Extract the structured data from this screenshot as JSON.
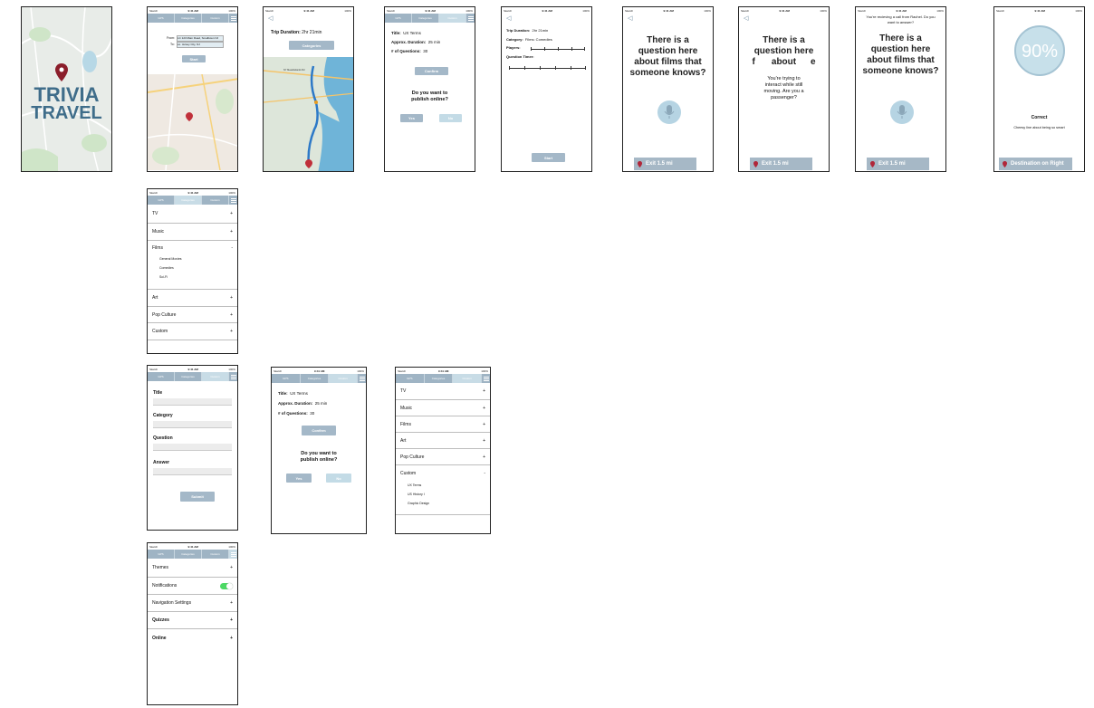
{
  "status": {
    "carrier": "Sketch",
    "time": "9:41 AM",
    "battery": "100%"
  },
  "tabs": [
    "GPS",
    "Categories",
    "Custom"
  ],
  "splash": {
    "title_line1": "TRIVIA",
    "title_line2": "TRAVEL"
  },
  "gps": {
    "from_label": "From:",
    "from_value": "LC 123 Main Road, Smalltown NJ",
    "to_label": "To:",
    "to_value": "ex. Jersey City, NJ",
    "start": "Start"
  },
  "route": {
    "trip_label": "Trip Duration:",
    "trip_value": "2hr 21min",
    "categories_btn": "Categories",
    "map_label1": "NY Meadowlands Rd"
  },
  "confirm": {
    "title_label": "Title:",
    "title_value": "UX Terms",
    "dur_label": "Approx. Duration:",
    "dur_value": "25 min",
    "num_label": "# of Questions:",
    "num_value": "30",
    "confirm_btn": "Confirm",
    "publish_q": "Do you want to publish online?",
    "yes": "Yes",
    "no": "No"
  },
  "setup": {
    "trip_label": "Trip Duration:",
    "trip_value": "2hr 21min",
    "cat_label": "Category:",
    "cat_value": "Films: Comedies",
    "players_label": "Players:",
    "timer_label": "Question Timer:",
    "start": "Start"
  },
  "question": {
    "text": "There is a question here about films that someone knows?",
    "exit": "Exit 1.5 mi"
  },
  "moving": {
    "text_top": "There is a question here about",
    "text_bottom": "f                      e",
    "popup": "You're trying to interact while still moving. Are you a passenger?",
    "exit": "Exit 1.5 mi"
  },
  "call": {
    "banner": "You're recieving a call from Rachel. Do you want to answer?",
    "text": "There is a question here about films that someone knows?",
    "exit": "Exit 1.5 mi"
  },
  "result": {
    "percent": "90%",
    "correct": "Correct",
    "line": "Cheesy line about being so smart",
    "dest": "Destination on Right"
  },
  "cat_list": {
    "items": [
      "TV",
      "Music",
      "Films",
      "Art",
      "Pop Culture",
      "Custom"
    ],
    "films_sub": [
      "General Movies",
      "Comedies",
      "Sci-Fi"
    ]
  },
  "custom_form": {
    "title": "Title",
    "category": "Category",
    "question": "Question",
    "answer": "Answer",
    "submit": "Submit"
  },
  "cat_list2": {
    "items": [
      "TV",
      "Music",
      "Films",
      "Art",
      "Pop Culture",
      "Custom"
    ],
    "custom_sub": [
      "UX Terms",
      "US History I",
      "Graphic Design"
    ]
  },
  "settings": {
    "items": [
      "Themes",
      "Notifications",
      "Navigation Settings",
      "Quizzes",
      "Online"
    ]
  },
  "colors": {
    "accent": "#a4b8c8",
    "light": "#c3dbe6",
    "pin": "#8b1e2b",
    "toggle": "#4cd964"
  }
}
